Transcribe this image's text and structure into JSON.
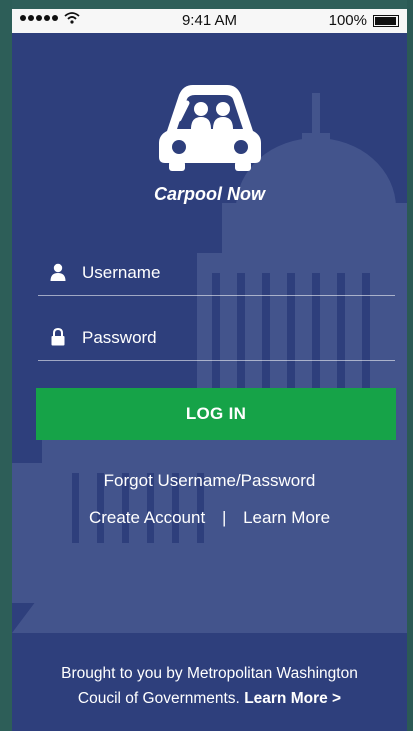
{
  "status_bar": {
    "time": "9:41 AM",
    "battery": "100%"
  },
  "app": {
    "name": "Carpool Now"
  },
  "form": {
    "username_placeholder": "Username",
    "password_placeholder": "Password",
    "login_label": "LOG IN"
  },
  "links": {
    "forgot": "Forgot Username/Password",
    "create_account": "Create Account",
    "separator": "|",
    "learn_more": "Learn More"
  },
  "footer": {
    "line1": "Brought to you by Metropolitan Washington",
    "line2": "Coucil of Governments.",
    "learn_more": "Learn More >"
  },
  "colors": {
    "background": "#2e3f7c",
    "login_button": "#16a348"
  }
}
